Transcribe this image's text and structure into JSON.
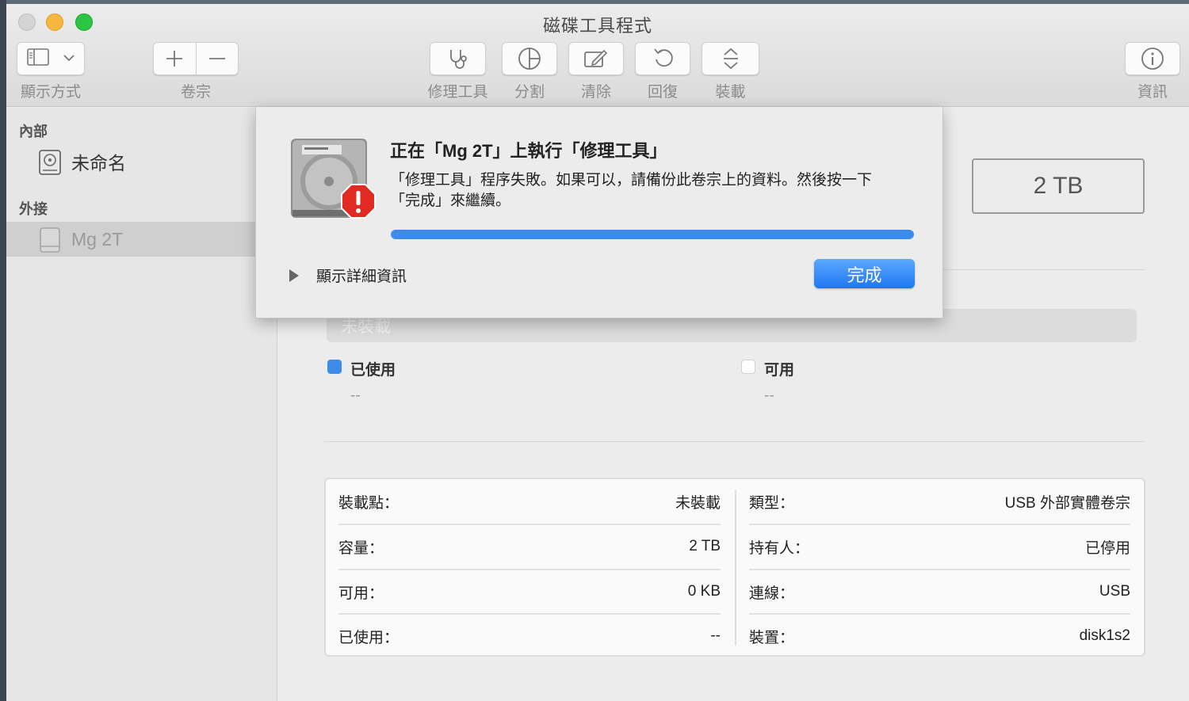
{
  "window": {
    "title": "磁碟工具程式"
  },
  "toolbar": {
    "view_label": "顯示方式",
    "volume_label": "卷宗",
    "first_aid_label": "修理工具",
    "partition_label": "分割",
    "erase_label": "清除",
    "restore_label": "回復",
    "mount_label": "裝載",
    "info_label": "資訊"
  },
  "sidebar": {
    "internal_heading": "內部",
    "external_heading": "外接",
    "items": [
      {
        "label": "未命名"
      },
      {
        "label": "Mg 2T"
      }
    ]
  },
  "main": {
    "capacity": "2 TB",
    "usage_bar_label": "未裝載",
    "legend": {
      "used_label": "已使用",
      "used_value": "--",
      "free_label": "可用",
      "free_value": "--",
      "used_color": "#3d8ceb",
      "free_color": "#ffffff"
    },
    "info": {
      "left": [
        {
          "key": "裝載點：",
          "value": "未裝載"
        },
        {
          "key": "容量：",
          "value": "2 TB"
        },
        {
          "key": "可用：",
          "value": "0 KB"
        },
        {
          "key": "已使用：",
          "value": "--"
        }
      ],
      "right": [
        {
          "key": "類型：",
          "value": "USB 外部實體卷宗"
        },
        {
          "key": "持有人：",
          "value": "已停用"
        },
        {
          "key": "連線：",
          "value": "USB"
        },
        {
          "key": "裝置：",
          "value": "disk1s2"
        }
      ]
    }
  },
  "dialog": {
    "title": "正在「Mg 2T」上執行「修理工具」",
    "message_line1": "「修理工具」程序失敗。如果可以，請備份此卷宗上的資料。然後按一下",
    "message_line2": "「完成」來繼續。",
    "progress": 1.0,
    "show_details_label": "顯示詳細資訊",
    "done_label": "完成",
    "accent_color": "#1f77f2"
  }
}
